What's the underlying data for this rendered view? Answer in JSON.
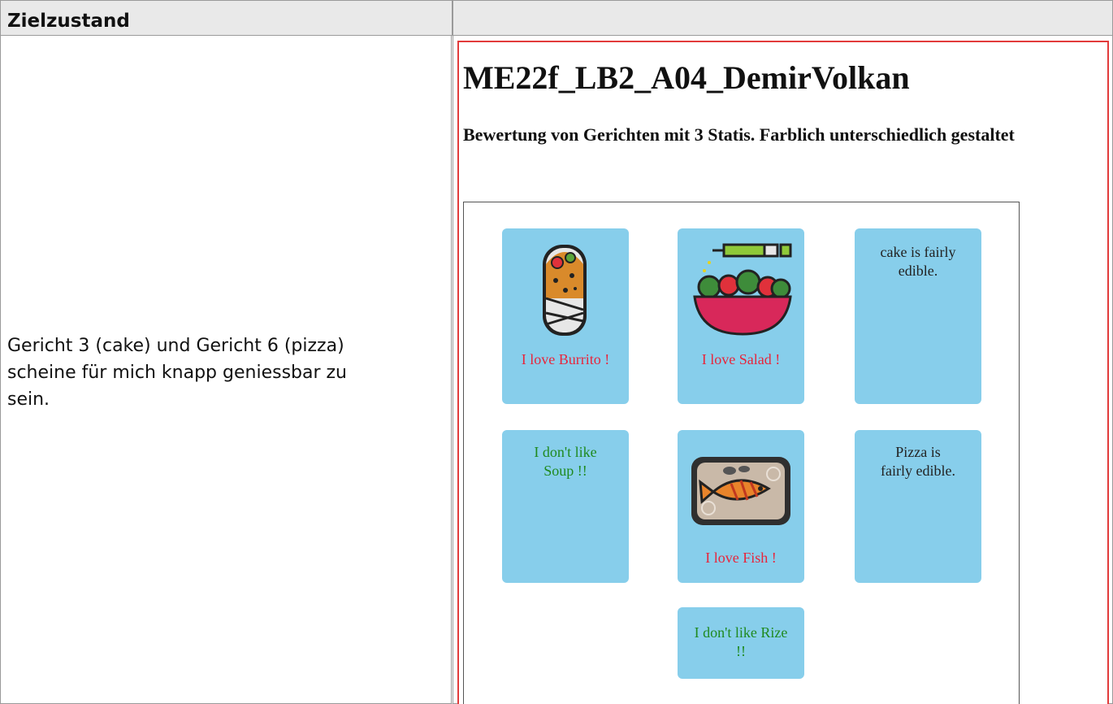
{
  "table": {
    "header_left": "Zielzustand",
    "header_right": "",
    "description": "Gericht 3 (cake) und Gericht 6 (pizza) scheine für mich knapp geniessbar zu sein."
  },
  "screenshot": {
    "title": "ME22f_LB2_A04_DemirVolkan",
    "subtitle": "Bewertung von Gerichten mit 3 Statis. Farblich unterschiedlich gestaltet",
    "cards": [
      {
        "dish": "burrito",
        "text": "I love Burrito !",
        "status": "love",
        "icon": "burrito-icon"
      },
      {
        "dish": "salad",
        "text": "I love Salad !",
        "status": "love",
        "icon": "salad-bowl-icon"
      },
      {
        "dish": "cake",
        "text": "cake is fairly edible.",
        "status": "fair",
        "icon": ""
      },
      {
        "dish": "soup",
        "text": "I don't like Soup !!",
        "status": "dislike",
        "icon": ""
      },
      {
        "dish": "fish",
        "text": "I love Fish !",
        "status": "love",
        "icon": "fish-tray-icon"
      },
      {
        "dish": "pizza",
        "text": "Pizza is fairly edible.",
        "status": "fair",
        "icon": ""
      },
      {
        "dish": "rice",
        "text": "I don't like Rize !!",
        "status": "dislike",
        "icon": ""
      }
    ],
    "colors": {
      "card_background": "#87ceeb",
      "love": "#e8253b",
      "dislike": "#1f8a1f",
      "fair": "#222222",
      "frame": "#e23b3b"
    }
  }
}
